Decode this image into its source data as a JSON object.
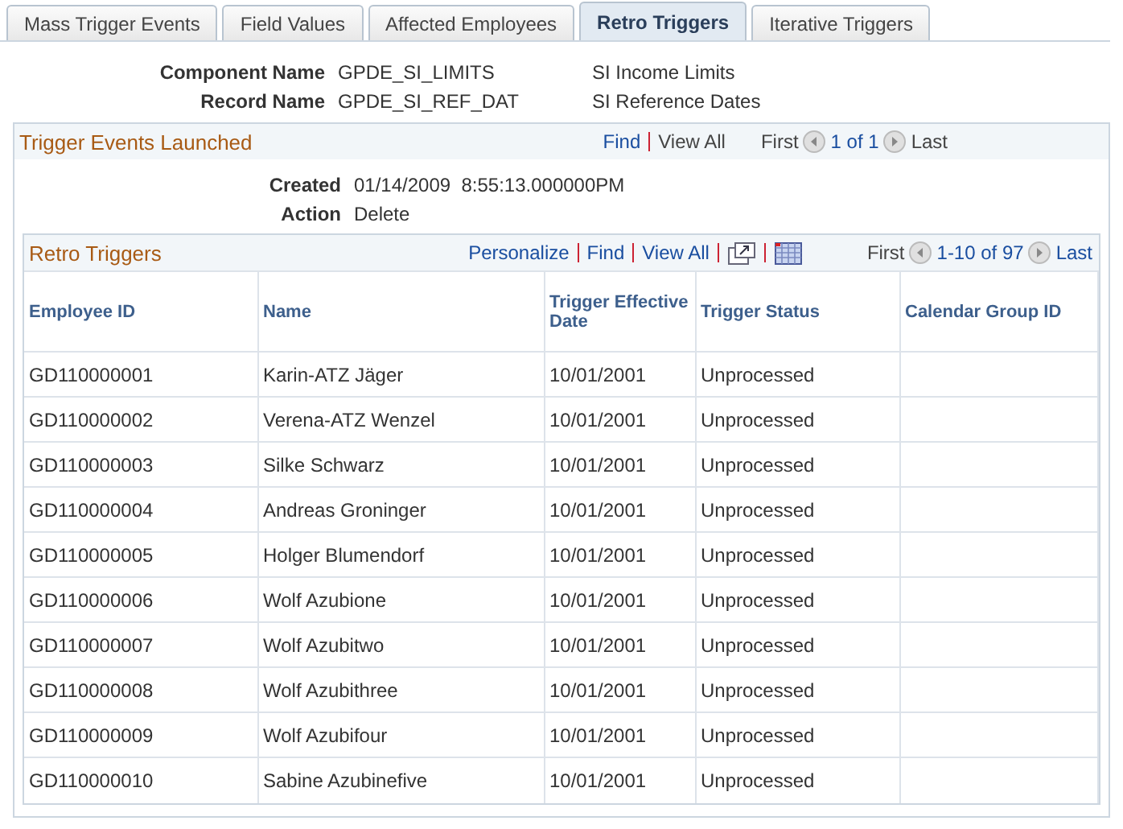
{
  "tabs": [
    {
      "label": "Mass Trigger Events",
      "selected": false
    },
    {
      "label": "Field Values",
      "selected": false
    },
    {
      "label": "Affected Employees",
      "selected": false
    },
    {
      "label": "Retro Triggers",
      "selected": true
    },
    {
      "label": "Iterative Triggers",
      "selected": false
    }
  ],
  "header_fields": [
    {
      "label": "Component Name",
      "value": "GPDE_SI_LIMITS",
      "description": "SI Income Limits"
    },
    {
      "label": "Record Name",
      "value": "GPDE_SI_REF_DAT",
      "description": "SI Reference Dates"
    }
  ],
  "trigger_events": {
    "title": "Trigger Events Launched",
    "links": [
      {
        "label": "Find",
        "disabled": false
      },
      {
        "label": "View All",
        "disabled": true
      }
    ],
    "nav": {
      "first": {
        "label": "First",
        "disabled": true
      },
      "range": "1 of 1",
      "last": {
        "label": "Last",
        "disabled": true
      }
    },
    "fields": [
      {
        "label": "Created",
        "value": "01/14/2009  8:55:13.000000PM"
      },
      {
        "label": "Action",
        "value": "Delete"
      }
    ]
  },
  "grid": {
    "title": "Retro Triggers",
    "links": [
      {
        "label": "Personalize",
        "disabled": false
      },
      {
        "label": "Find",
        "disabled": false
      },
      {
        "label": "View All",
        "disabled": false
      }
    ],
    "nav": {
      "first": {
        "label": "First",
        "disabled": true
      },
      "range": "1-10 of 97",
      "last": {
        "label": "Last",
        "disabled": false
      }
    },
    "columns": [
      "Employee ID",
      "Name",
      "Trigger Effective Date",
      "Trigger Status",
      "Calendar Group ID"
    ],
    "rows": [
      [
        "GD110000001",
        "Karin-ATZ Jäger",
        "10/01/2001",
        "Unprocessed"
      ],
      [
        "GD110000002",
        "Verena-ATZ Wenzel",
        "10/01/2001",
        "Unprocessed"
      ],
      [
        "GD110000003",
        "Silke Schwarz",
        "10/01/2001",
        "Unprocessed"
      ],
      [
        "GD110000004",
        "Andreas Groninger",
        "10/01/2001",
        "Unprocessed"
      ],
      [
        "GD110000005",
        "Holger Blumendorf",
        "10/01/2001",
        "Unprocessed"
      ],
      [
        "GD110000006",
        "Wolf Azubione",
        "10/01/2001",
        "Unprocessed"
      ],
      [
        "GD110000007",
        "Wolf Azubitwo",
        "10/01/2001",
        "Unprocessed"
      ],
      [
        "GD110000008",
        "Wolf Azubithree",
        "10/01/2001",
        "Unprocessed"
      ],
      [
        "GD110000009",
        "Wolf Azubifour",
        "10/01/2001",
        "Unprocessed"
      ],
      [
        "GD110000010",
        "Sabine Azubinefive",
        "10/01/2001",
        "Unprocessed"
      ]
    ]
  }
}
